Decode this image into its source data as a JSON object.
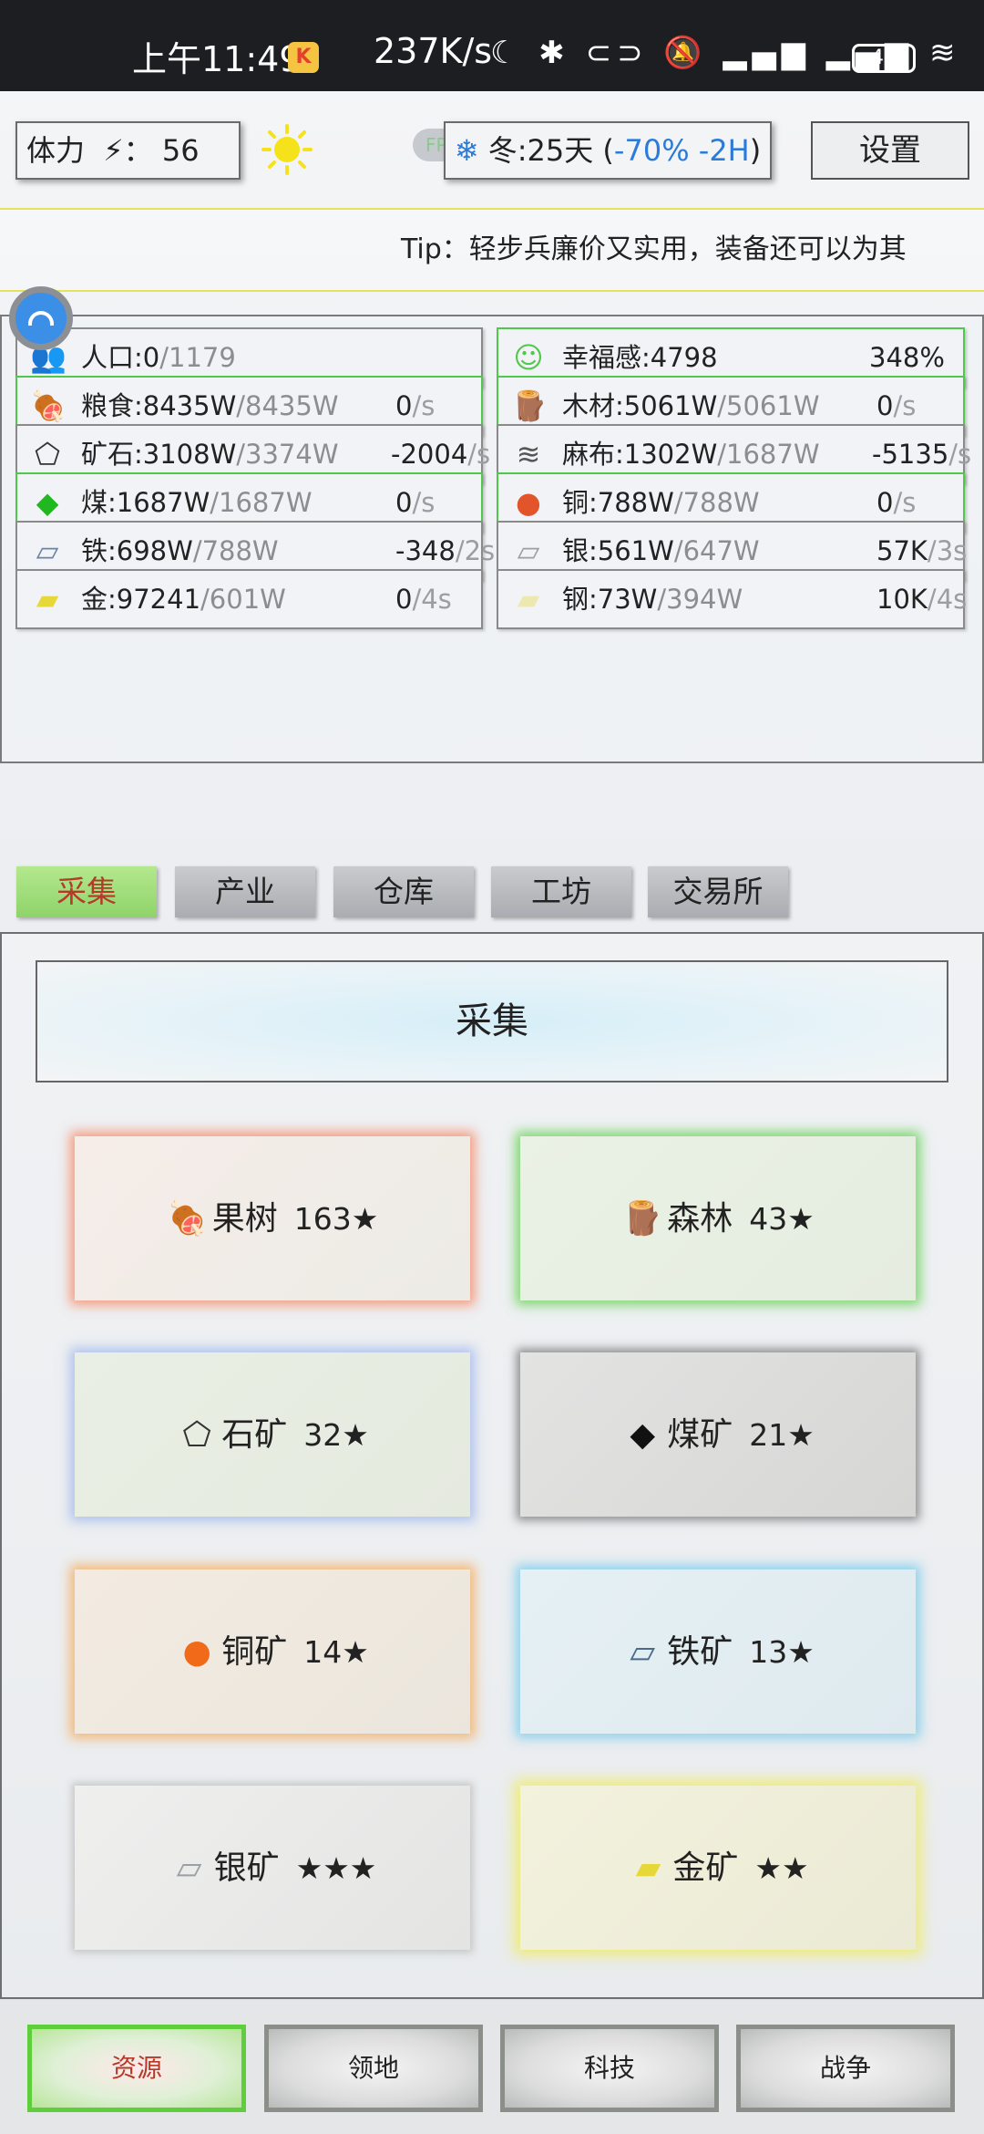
{
  "status_bar": {
    "time": "上午11:49",
    "speed": "237K/s",
    "icons_text": "☾ ✱ ⊂⊃ 🔕 ▂▄▆ ▂▄▆ ≋",
    "battery": "46"
  },
  "header": {
    "stamina_label": "体力",
    "stamina_sep": "⚡：",
    "stamina_value": "56",
    "fps_label": "FPS",
    "season_text": "冬:25天 (",
    "season_mods": "-70% -2H",
    "season_close": ")",
    "settings_label": "设置"
  },
  "tip": {
    "text": "Tip：轻步兵廉价又实用，装备还可以为其"
  },
  "resources": [
    {
      "name": "人口:0",
      "cap": "/1179",
      "rate": "",
      "unit": "",
      "icon": "👥",
      "highlight": false
    },
    {
      "name": "幸福感:4798",
      "cap": "",
      "rate": "348%",
      "unit": "",
      "icon": "☺",
      "highlight": true
    },
    {
      "name": "粮食:8435W",
      "cap": "/8435W",
      "rate": "0",
      "unit": "/s",
      "icon": "🍖",
      "highlight": true
    },
    {
      "name": "木材:5061W",
      "cap": "/5061W",
      "rate": "0",
      "unit": "/s",
      "icon": "🪵",
      "highlight": true
    },
    {
      "name": "矿石:3108W",
      "cap": "/3374W",
      "rate": "-2004",
      "unit": "/s",
      "icon": "⬠",
      "highlight": false
    },
    {
      "name": "麻布:1302W",
      "cap": "/1687W",
      "rate": "-5135",
      "unit": "/s",
      "icon": "≋",
      "highlight": false
    },
    {
      "name": "煤:1687W",
      "cap": "/1687W",
      "rate": "0",
      "unit": "/s",
      "icon": "◆",
      "highlight": true
    },
    {
      "name": "铜:788W",
      "cap": "/788W",
      "rate": "0",
      "unit": "/s",
      "icon": "●",
      "highlight": true
    },
    {
      "name": "铁:698W",
      "cap": "/788W",
      "rate": "-348",
      "unit": "/2s",
      "icon": "▱",
      "highlight": false
    },
    {
      "name": "银:561W",
      "cap": "/647W",
      "rate": "57K",
      "unit": "/3s",
      "icon": "▱",
      "highlight": false
    },
    {
      "name": "金:97241",
      "cap": "/601W",
      "rate": "0",
      "unit": "/4s",
      "icon": "▰",
      "highlight": false
    },
    {
      "name": "钢:73W",
      "cap": "/394W",
      "rate": "10K",
      "unit": "/4s",
      "icon": "▰",
      "highlight": false
    }
  ],
  "tabs": [
    "采集",
    "产业",
    "仓库",
    "工坊",
    "交易所"
  ],
  "active_tab": "采集",
  "banner_title": "采集",
  "gather_cards": [
    {
      "icon": "🍖",
      "name": "果树",
      "level": "163★"
    },
    {
      "icon": "🪵",
      "name": "森林",
      "level": "43★"
    },
    {
      "icon": "⬠",
      "name": "石矿",
      "level": "32★"
    },
    {
      "icon": "◆",
      "name": "煤矿",
      "level": "21★"
    },
    {
      "icon": "●",
      "name": "铜矿",
      "level": "14★"
    },
    {
      "icon": "▱",
      "name": "铁矿",
      "level": "13★"
    },
    {
      "icon": "▱",
      "name": "银矿",
      "level": "★★★"
    },
    {
      "icon": "▰",
      "name": "金矿",
      "level": "★★"
    }
  ],
  "bottom_nav": [
    "资源",
    "领地",
    "科技",
    "战争"
  ],
  "active_nav": "资源",
  "colors": {
    "highlight_border": "#4fc84c",
    "active_tab_bg": "#8fd36a",
    "active_text": "#b53a2a",
    "season_modifier": "#2d7bd8",
    "tip_border": "#e6e25a"
  }
}
